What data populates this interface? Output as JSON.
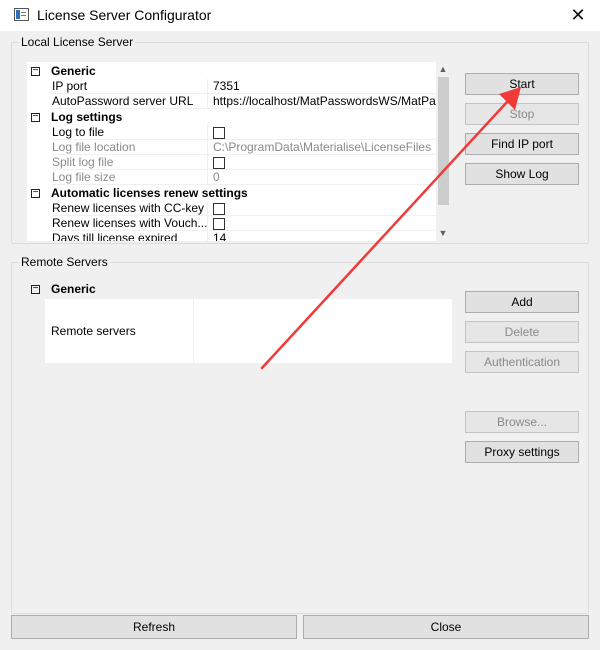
{
  "window": {
    "title": "License Server Configurator",
    "close_glyph": "✕"
  },
  "local_server": {
    "group_label": "Local License Server",
    "categories": [
      {
        "name": "Generic",
        "toggle": "−",
        "rows": [
          {
            "name": "IP port",
            "value": "7351",
            "type": "text",
            "disabled": false
          },
          {
            "name": "AutoPassword server URL",
            "value": "https://localhost/MatPasswordsWS/MatPassword",
            "type": "text",
            "disabled": false
          }
        ]
      },
      {
        "name": "Log settings",
        "toggle": "−",
        "rows": [
          {
            "name": "Log to file",
            "value": "",
            "type": "checkbox",
            "checked": false,
            "disabled": false
          },
          {
            "name": "Log file location",
            "value": "C:\\ProgramData\\Materialise\\LicenseFiles",
            "type": "text",
            "disabled": true
          },
          {
            "name": "Split log file",
            "value": "",
            "type": "checkbox",
            "checked": false,
            "disabled": true
          },
          {
            "name": "Log file size",
            "value": "0",
            "type": "text",
            "disabled": true
          }
        ]
      },
      {
        "name": "Automatic licenses renew settings",
        "toggle": "−",
        "rows": [
          {
            "name": "Renew licenses with CC-key",
            "value": "",
            "type": "checkbox",
            "checked": false,
            "disabled": false
          },
          {
            "name": "Renew licenses with Vouch...",
            "value": "",
            "type": "checkbox",
            "checked": false,
            "disabled": false
          },
          {
            "name": "Days till license expired",
            "value": "14",
            "type": "text",
            "disabled": false
          }
        ]
      }
    ],
    "buttons": {
      "start": "Start",
      "stop": "Stop",
      "find_ip_port": "Find IP port",
      "show_log": "Show Log"
    }
  },
  "remote_servers": {
    "group_label": "Remote Servers",
    "category": "Generic",
    "toggle": "−",
    "row_label": "Remote servers",
    "row_value": "",
    "buttons": {
      "add": "Add",
      "delete": "Delete",
      "authentication": "Authentication",
      "browse": "Browse...",
      "proxy_settings": "Proxy settings"
    }
  },
  "footer": {
    "refresh": "Refresh",
    "close": "Close"
  },
  "scrollbar": {
    "up_glyph": "▲",
    "down_glyph": "▼"
  },
  "annotation": {
    "color": "#f03a3a"
  }
}
